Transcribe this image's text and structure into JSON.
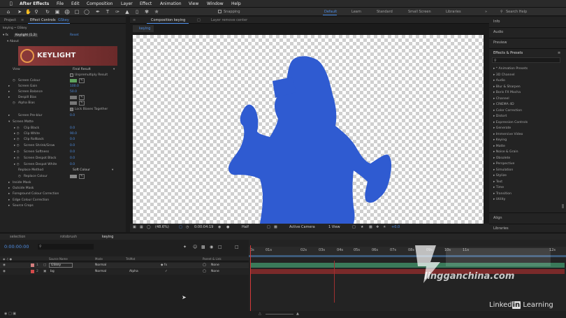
{
  "menubar": {
    "app_name": "After Effects",
    "items": [
      "File",
      "Edit",
      "Composition",
      "Layer",
      "Effect",
      "Animation",
      "View",
      "Window",
      "Help"
    ]
  },
  "toolbar": {
    "snapping_label": "Snapping",
    "workspaces": [
      "Default",
      "Learn",
      "Standard",
      "Small Screen",
      "Libraries"
    ],
    "search_placeholder": "Search Help"
  },
  "project_panel": {
    "tab_project": "Project",
    "tab_effect_controls": "Effect Controls",
    "ec_layer": "GSkey",
    "breadcrumb": "keying • GSkey"
  },
  "effect_controls": {
    "effect_name": "Keylight (1.2)",
    "reset": "Reset",
    "about": "About",
    "logo_text": "KEYLIGHT",
    "rows": [
      {
        "label": "View",
        "value": "Final Result"
      },
      {
        "label": "",
        "value": "Unpremultiply Result"
      },
      {
        "label": "Screen Colour",
        "value": ""
      },
      {
        "label": "Screen Gain",
        "value": "100.0"
      },
      {
        "label": "Screen Balance",
        "value": "50.0"
      },
      {
        "label": "Despill Bias",
        "value": ""
      },
      {
        "label": "Alpha Bias",
        "value": ""
      },
      {
        "label": "",
        "value": "Lock Biases Together"
      },
      {
        "label": "Screen Pre-blur",
        "value": "0.0"
      },
      {
        "label": "Screen Matte",
        "value": ""
      },
      {
        "label": "Clip Black",
        "value": "0.0"
      },
      {
        "label": "Clip White",
        "value": "90.0"
      },
      {
        "label": "Clip Rollback",
        "value": "0.0"
      },
      {
        "label": "Screen Shrink/Grow",
        "value": "0.0"
      },
      {
        "label": "Screen Softness",
        "value": "0.0"
      },
      {
        "label": "Screen Despot Black",
        "value": "0.0"
      },
      {
        "label": "Screen Despot White",
        "value": "0.0"
      },
      {
        "label": "Replace Method",
        "value": "Soft Colour"
      },
      {
        "label": "Replace Colour",
        "value": ""
      },
      {
        "label": "Inside Mask",
        "value": ""
      },
      {
        "label": "Outside Mask",
        "value": ""
      },
      {
        "label": "Foreground Colour Correction",
        "value": ""
      },
      {
        "label": "Edge Colour Correction",
        "value": ""
      },
      {
        "label": "Source Crops",
        "value": ""
      }
    ]
  },
  "composition_panel": {
    "tab_label": "Composition keying",
    "layer_tab": "Layer remove center",
    "sub_tab": "keying",
    "viewer_bar": {
      "zoom": "(48.6%)",
      "timecode": "0:00:04:19",
      "resolution": "Half",
      "camera": "Active Camera",
      "views": "1 View",
      "exposure": "+0.0"
    }
  },
  "right_panel": {
    "info": "Info",
    "audio": "Audio",
    "preview": "Preview",
    "effects_presets": "Effects & Presets",
    "search_placeholder": "",
    "categories": [
      "* Animation Presets",
      "3D Channel",
      "Audio",
      "Blur & Sharpen",
      "Boris FX Mocha",
      "Channel",
      "CINEMA 4D",
      "Color Correction",
      "Distort",
      "Expression Controls",
      "Generate",
      "Immersive Video",
      "Keying",
      "Matte",
      "Noise & Grain",
      "Obsolete",
      "Perspective",
      "Simulation",
      "Stylize",
      "Text",
      "Time",
      "Transition",
      "Utility"
    ],
    "align": "Align",
    "libraries": "Libraries"
  },
  "timeline": {
    "tabs": [
      "selection",
      "rotobrush",
      "keying"
    ],
    "timecode": "0:00:00:00",
    "columns": {
      "source_name": "Source Name",
      "mode": "Mode",
      "trkmat": "TrkMat",
      "parent": "Parent & Link"
    },
    "layers": [
      {
        "num": "1",
        "name": "GSkey",
        "mode": "Normal",
        "trkmat": "",
        "parent": "None"
      },
      {
        "num": "2",
        "name": "bg",
        "mode": "Normal",
        "trkmat": "Alpha",
        "parent": "None"
      }
    ],
    "ruler": [
      "0s",
      "01s",
      "02s",
      "03s",
      "04s",
      "05s",
      "06s",
      "07s",
      "08s",
      "09s",
      "10s",
      "11s",
      "12s"
    ]
  },
  "watermark": {
    "brand": "lingganchina.com"
  },
  "linkedin": {
    "prefix": "Linked",
    "in": "in",
    "suffix": "Learning"
  },
  "colors": {
    "matte_blue": "#2f5bd1",
    "accent": "#4d8ee8",
    "layer_green": "#3a7a5a",
    "layer_red": "#7a2a2a"
  }
}
